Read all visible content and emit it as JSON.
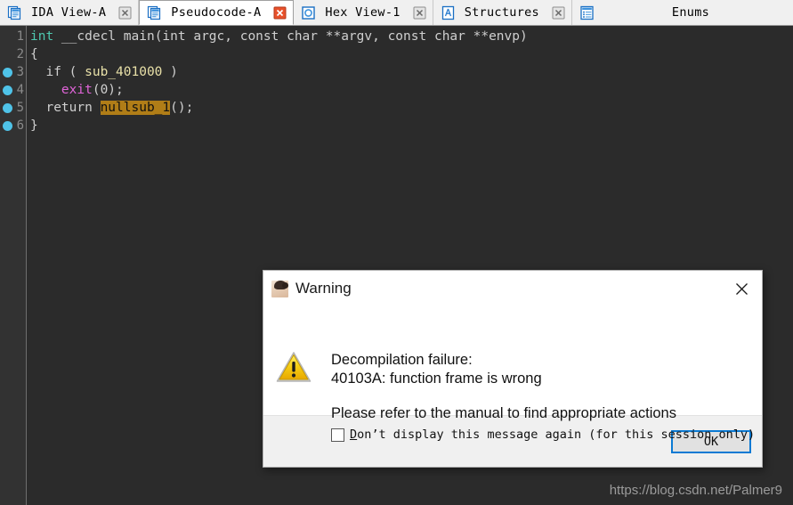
{
  "tabs": [
    {
      "label": "IDA View-A",
      "icon": "document-view-icon",
      "active": false,
      "close_style": "grey"
    },
    {
      "label": "Pseudocode-A",
      "icon": "document-view-icon",
      "active": true,
      "close_style": "red"
    },
    {
      "label": "Hex View-1",
      "icon": "hex-view-icon",
      "active": false,
      "close_style": "grey"
    },
    {
      "label": "Structures",
      "icon": "structures-icon",
      "active": false,
      "close_style": "grey"
    },
    {
      "label": "Enums",
      "icon": "enums-icon",
      "active": false,
      "close_style": "none"
    }
  ],
  "editor": {
    "lines": [
      {
        "number": "1",
        "breakpoint": false,
        "tokens": [
          {
            "text": "int",
            "cls": "tok-kw"
          },
          {
            "text": " __cdecl main(int argc, const char **argv, const char **envp)",
            "cls": "tok-plain"
          }
        ]
      },
      {
        "number": "2",
        "breakpoint": false,
        "tokens": [
          {
            "text": "{",
            "cls": "tok-plain"
          }
        ]
      },
      {
        "number": "3",
        "breakpoint": true,
        "tokens": [
          {
            "text": "  if ( ",
            "cls": "tok-plain"
          },
          {
            "text": "sub_401000",
            "cls": "tok-func"
          },
          {
            "text": " )",
            "cls": "tok-plain"
          }
        ]
      },
      {
        "number": "4",
        "breakpoint": true,
        "tokens": [
          {
            "text": "    ",
            "cls": "tok-plain"
          },
          {
            "text": "exit",
            "cls": "tok-lib"
          },
          {
            "text": "(0);",
            "cls": "tok-plain"
          }
        ]
      },
      {
        "number": "5",
        "breakpoint": true,
        "tokens": [
          {
            "text": "  return ",
            "cls": "tok-plain"
          },
          {
            "text": "nullsub_1",
            "cls": "tok-hl"
          },
          {
            "text": "();",
            "cls": "tok-plain"
          }
        ]
      },
      {
        "number": "6",
        "breakpoint": true,
        "tokens": [
          {
            "text": "}",
            "cls": "tok-plain"
          }
        ]
      }
    ]
  },
  "watermark": "https://blog.csdn.net/Palmer9",
  "dialog": {
    "title": "Warning",
    "close_label": "✕",
    "message_line1": "Decompilation failure:",
    "message_line2": "40103A: function frame is wrong",
    "message_line3": "Please refer to the manual to find appropriate actions",
    "checkbox_prefix": "D",
    "checkbox_rest": "on’t display this message again (for this session only)",
    "checkbox_checked": false,
    "ok_label": "OK"
  },
  "colors": {
    "editor_bg": "#2b2b2b",
    "gutter_bg": "#323232",
    "breakpoint": "#4fc3e8",
    "keyword": "#4ec9b0",
    "function": "#e8e0a8",
    "library_call": "#e064d8",
    "highlight_bg": "#b07d17",
    "tabbar_bg": "#f0f0f0",
    "focus_border": "#0a7ad4",
    "warning_yellow": "#f2c200"
  }
}
